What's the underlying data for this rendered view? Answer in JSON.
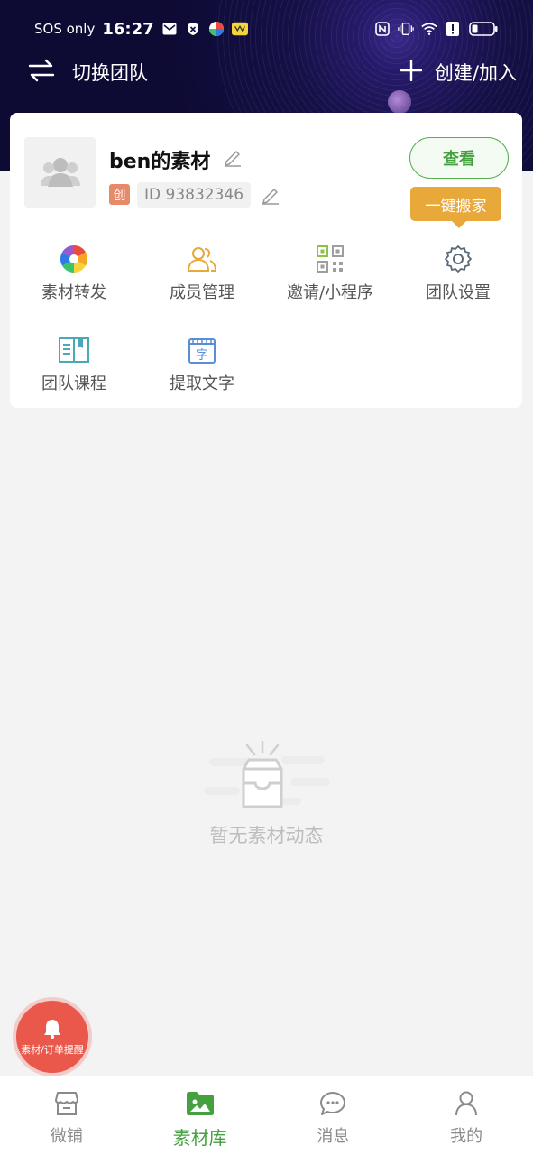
{
  "status_bar": {
    "sos": "SOS only",
    "time": "16:27"
  },
  "header": {
    "switch_label": "切换团队",
    "create_label": "创建/加入"
  },
  "team": {
    "name": "ben的素材",
    "creator_badge": "创",
    "id_text": "ID 93832346",
    "view_label": "查看",
    "move_label": "一键搬家"
  },
  "functions": [
    {
      "label": "素材转发",
      "icon": "aperture-icon"
    },
    {
      "label": "成员管理",
      "icon": "members-icon"
    },
    {
      "label": "邀请/小程序",
      "icon": "qrcode-icon"
    },
    {
      "label": "团队设置",
      "icon": "gear-icon"
    },
    {
      "label": "团队课程",
      "icon": "book-icon"
    },
    {
      "label": "提取文字",
      "icon": "extract-text-icon"
    }
  ],
  "extract_icon_char": "字",
  "empty": {
    "text": "暂无素材动态"
  },
  "fab": {
    "label": "素材/订单提醒"
  },
  "tabs": [
    {
      "label": "微铺",
      "icon": "shop-icon"
    },
    {
      "label": "素材库",
      "icon": "image-folder-icon",
      "active": true
    },
    {
      "label": "消息",
      "icon": "chat-icon"
    },
    {
      "label": "我的",
      "icon": "user-icon"
    }
  ],
  "colors": {
    "accent": "#45a040",
    "warning": "#e8a83a",
    "fab": "#e9584a",
    "header_bg": "#151046"
  }
}
